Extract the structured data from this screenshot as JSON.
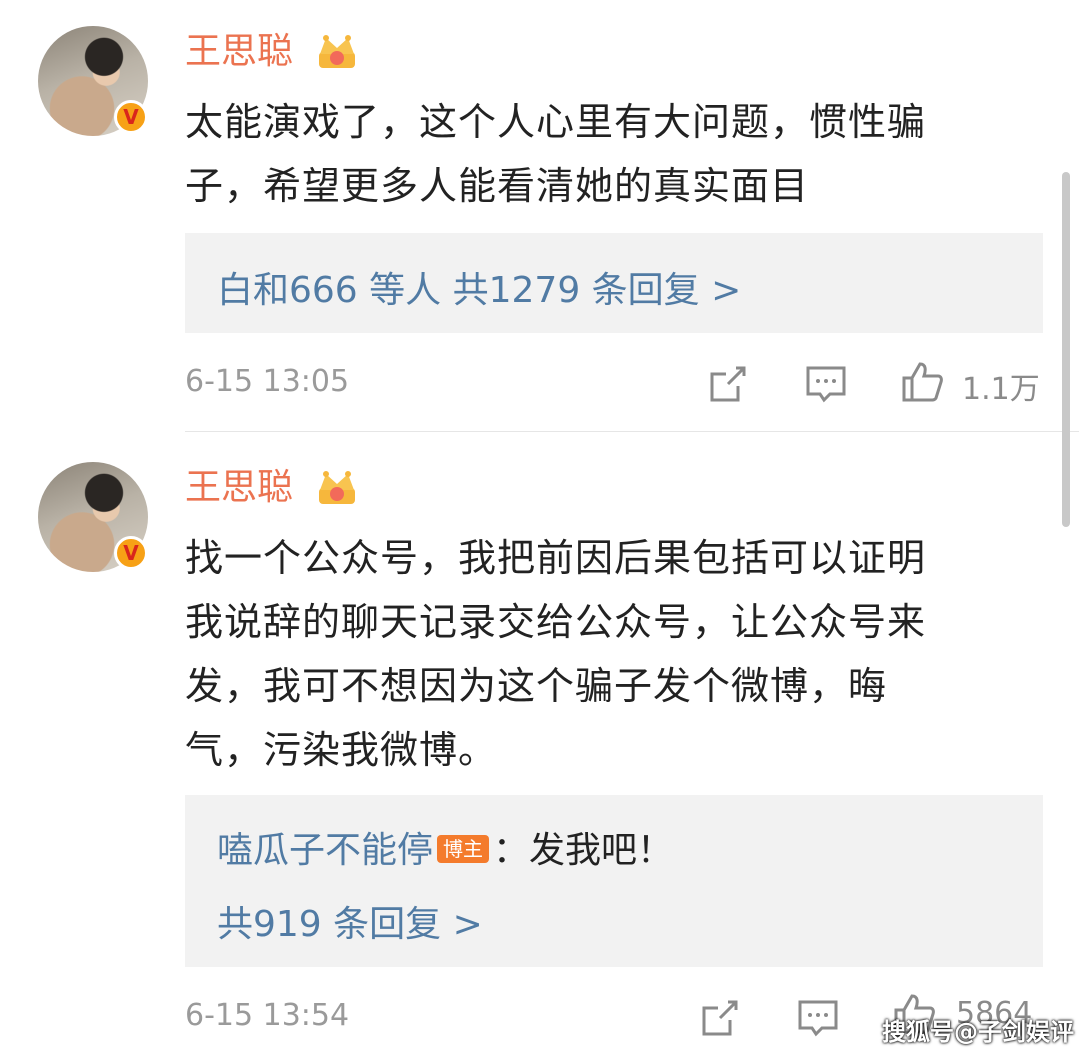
{
  "comments": [
    {
      "username": "王思聪",
      "verified_badge": "V",
      "text_line1": "太能演戏了，这个人心里有大问题，惯性骗",
      "text_line2": "子，希望更多人能看清她的真实面目",
      "reply_summary": "白和666 等人  共1279 条回复 >",
      "time": "6-15 13:05",
      "like_count": "1.1万"
    },
    {
      "username": "王思聪",
      "verified_badge": "V",
      "text_line1": "找一个公众号，我把前因后果包括可以证明",
      "text_line2": "我说辞的聊天记录交给公众号，让公众号来",
      "text_line3": "发，我可不想因为这个骗子发个微博，晦",
      "text_line4": "气，污染我微博。",
      "reply_user": "嗑瓜子不能停",
      "reply_badge": "博主",
      "reply_text": "：发我吧！",
      "reply_summary": "共919 条回复 >",
      "time": "6-15 13:54",
      "like_count": "5864"
    }
  ],
  "watermark": "搜狐号@子剑娱评",
  "colors": {
    "username": "#eb7350",
    "link": "#517ba4",
    "meta": "#9a9a9a",
    "reply_bg": "#f2f2f2",
    "badge_orange": "#f47b2c"
  },
  "icons": [
    "avatar",
    "crown-icon",
    "verified-badge-icon",
    "share-icon",
    "comment-icon",
    "like-icon"
  ]
}
